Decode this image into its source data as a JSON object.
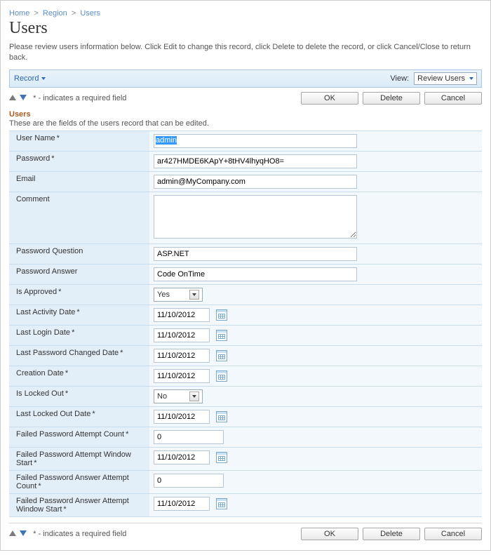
{
  "breadcrumb": {
    "items": [
      "Home",
      "Region",
      "Users"
    ]
  },
  "page_title": "Users",
  "intro": "Please review users information below. Click Edit to change this record, click Delete to delete the record, or click Cancel/Close to return back.",
  "bar": {
    "record_label": "Record",
    "view_label": "View:",
    "view_value": "Review Users"
  },
  "hint_text": "* - indicates a required field",
  "buttons": {
    "ok": "OK",
    "delete": "Delete",
    "cancel": "Cancel"
  },
  "section": {
    "title": "Users",
    "desc": "These are the fields of the users record that can be edited."
  },
  "fields": {
    "username": {
      "label": "User Name",
      "value": "admin",
      "required": true
    },
    "password": {
      "label": "Password",
      "value": "ar427HMDE6KApY+8tHV4lhyqHO8=",
      "required": true
    },
    "email": {
      "label": "Email",
      "value": "admin@MyCompany.com",
      "required": false
    },
    "comment": {
      "label": "Comment",
      "value": "",
      "required": false
    },
    "pw_question": {
      "label": "Password Question",
      "value": "ASP.NET",
      "required": false
    },
    "pw_answer": {
      "label": "Password Answer",
      "value": "Code OnTime",
      "required": false
    },
    "is_approved": {
      "label": "Is Approved",
      "value": "Yes",
      "required": true
    },
    "last_activity": {
      "label": "Last Activity Date",
      "value": "11/10/2012",
      "required": true
    },
    "last_login": {
      "label": "Last Login Date",
      "value": "11/10/2012",
      "required": true
    },
    "last_pw_changed": {
      "label": "Last Password Changed Date",
      "value": "11/10/2012",
      "required": true
    },
    "creation": {
      "label": "Creation Date",
      "value": "11/10/2012",
      "required": true
    },
    "is_locked": {
      "label": "Is Locked Out",
      "value": "No",
      "required": true
    },
    "last_locked": {
      "label": "Last Locked Out Date",
      "value": "11/10/2012",
      "required": true
    },
    "fail_pw_count": {
      "label": "Failed Password Attempt Count",
      "value": "0",
      "required": true
    },
    "fail_pw_win": {
      "label": "Failed Password Attempt Window Start",
      "value": "11/10/2012",
      "required": true
    },
    "fail_ans_count": {
      "label": "Failed Password Answer Attempt Count",
      "value": "0",
      "required": true
    },
    "fail_ans_win": {
      "label": "Failed Password Answer Attempt Window Start",
      "value": "11/10/2012",
      "required": true
    }
  }
}
